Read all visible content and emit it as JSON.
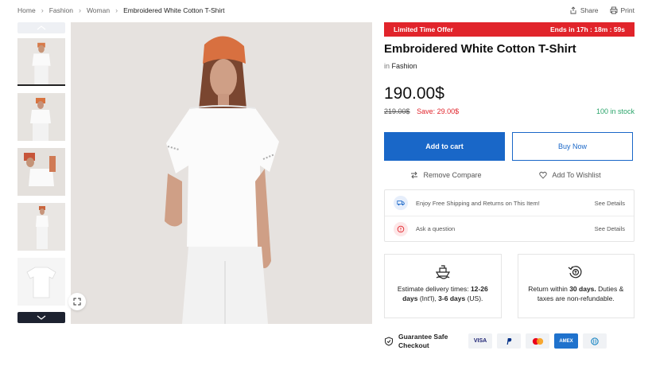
{
  "breadcrumb": [
    "Home",
    "Fashion",
    "Woman",
    "Embroidered White Cotton T-Shirt"
  ],
  "top_actions": {
    "share": "Share",
    "print": "Print"
  },
  "offer": {
    "label": "Limited Time Offer",
    "ends_prefix": "Ends in ",
    "h": "17h",
    "m": "18m",
    "s": "59s",
    "sep": " : "
  },
  "product": {
    "title": "Embroidered White Cotton T-Shirt",
    "category_prefix": "in ",
    "category": "Fashion",
    "price": "190.00$",
    "old_price": "219.00$",
    "save": "Save: 29.00$",
    "stock": "100 in stock"
  },
  "buttons": {
    "add_to_cart": "Add to cart",
    "buy_now": "Buy Now",
    "remove_compare": "Remove Compare",
    "add_wishlist": "Add To Wishlist"
  },
  "info": [
    {
      "text": "Enjoy Free Shipping and Returns on This Item!",
      "link": "See Details"
    },
    {
      "text": "Ask a question",
      "link": "See Details"
    }
  ],
  "delivery": {
    "t1": "Estimate delivery times: ",
    "b1": "12-26 days",
    "t2": " (Int'l), ",
    "b2": "3-6 days",
    "t3": " (US)."
  },
  "returns": {
    "t1": "Return within ",
    "b1": "30 days.",
    "t2": " Duties & taxes are non-refundable."
  },
  "checkout": {
    "label": "Guarantee Safe Checkout",
    "methods": [
      "VISA",
      "P",
      "mastercard",
      "AMEX",
      "D"
    ]
  },
  "colors": {
    "accent": "#1967c8",
    "offer": "#e1242b",
    "stock": "#2aa46a"
  }
}
